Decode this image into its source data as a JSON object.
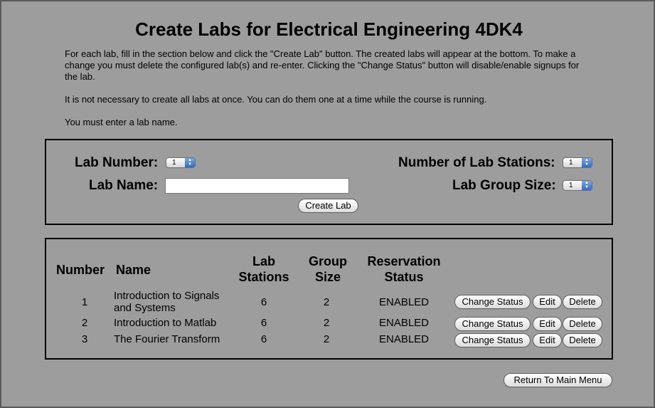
{
  "page": {
    "title": "Create Labs for Electrical Engineering 4DK4",
    "intro": [
      "For each lab, fill in the section below and click the \"Create Lab\" button. The created labs will appear at the bottom. To make a change you must delete the configured lab(s) and re-enter. Clicking the \"Change Status\" button will disable/enable signups for the lab.",
      "It is not necessary to create all labs at once. You can do them one at a time while the course is running.",
      "You must enter a lab name."
    ]
  },
  "form": {
    "lab_number_label": "Lab Number:",
    "lab_number_value": "1",
    "lab_name_label": "Lab Name:",
    "lab_name_value": "",
    "stations_label": "Number of Lab Stations:",
    "stations_value": "1",
    "group_size_label": "Lab Group Size:",
    "group_size_value": "1",
    "create_button": "Create Lab"
  },
  "table": {
    "headers": {
      "number": "Number",
      "name": "Name",
      "stations": "Lab Stations",
      "group_size": "Group Size",
      "status": "Reservation Status"
    },
    "rows": [
      {
        "number": "1",
        "name": "Introduction to Signals and Systems",
        "stations": "6",
        "group_size": "2",
        "status": "ENABLED"
      },
      {
        "number": "2",
        "name": "Introduction to Matlab",
        "stations": "6",
        "group_size": "2",
        "status": "ENABLED"
      },
      {
        "number": "3",
        "name": "The Fourier Transform",
        "stations": "6",
        "group_size": "2",
        "status": "ENABLED"
      }
    ],
    "change_status_label": "Change Status",
    "edit_label": "Edit",
    "delete_label": "Delete"
  },
  "return_button": "Return To Main Menu"
}
